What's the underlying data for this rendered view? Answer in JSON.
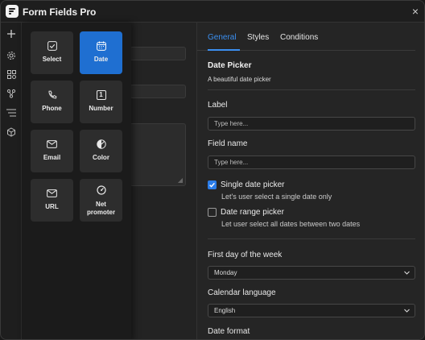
{
  "window": {
    "title": "Form Fields Pro",
    "close_glyph": "×"
  },
  "rail": {
    "icons": [
      "plus-icon",
      "gear-icon",
      "grid-icon",
      "connections-icon",
      "list-icon",
      "cube-icon"
    ]
  },
  "palette": {
    "tiles": [
      {
        "label": "Select",
        "icon": "checkbox-icon",
        "active": false
      },
      {
        "label": "Date",
        "icon": "calendar-icon",
        "active": true
      },
      {
        "label": "Phone",
        "icon": "phone-icon",
        "active": false
      },
      {
        "label": "Number",
        "icon": "number-icon",
        "icon_text": "1",
        "active": false
      },
      {
        "label": "Email",
        "icon": "mail-icon",
        "active": false
      },
      {
        "label": "Color",
        "icon": "color-icon",
        "active": false
      },
      {
        "label": "URL",
        "icon": "url-icon",
        "active": false
      },
      {
        "label": "Net promoter",
        "icon": "gauge-icon",
        "active": false
      }
    ]
  },
  "panel": {
    "tabs": [
      {
        "label": "General",
        "active": true
      },
      {
        "label": "Styles",
        "active": false
      },
      {
        "label": "Conditions",
        "active": false
      }
    ],
    "section_title": "Date Picker",
    "section_desc": "A beautiful date picker",
    "label_field": {
      "label": "Label",
      "placeholder": "Type here..."
    },
    "name_field": {
      "label": "Field name",
      "placeholder": "Type here..."
    },
    "single_picker": {
      "label": "Single date picker",
      "help": "Let's user select a single date only",
      "checked": true
    },
    "range_picker": {
      "label": "Date range picker",
      "help": "Let user select all dates between two dates",
      "checked": false
    },
    "first_day": {
      "label": "First day of the week",
      "value": "Monday"
    },
    "calendar_language": {
      "label": "Calendar language",
      "value": "English"
    },
    "date_format": {
      "label": "Date format"
    }
  },
  "colors": {
    "accent": "#1f6fd1",
    "link": "#3b8ff0",
    "background": "#262626"
  }
}
